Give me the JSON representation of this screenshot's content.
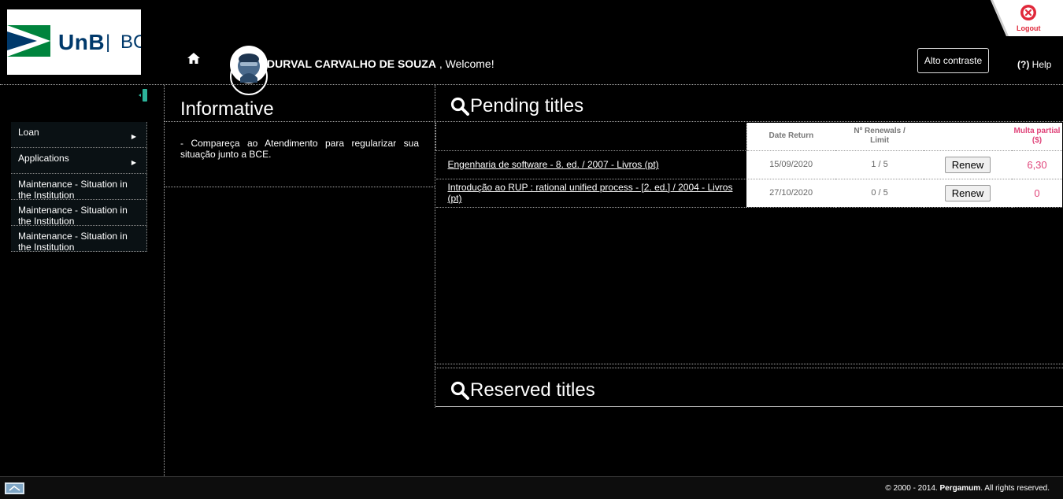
{
  "header": {
    "logo_text": "UnB",
    "logo_separator": "|",
    "logo_suffix": "BC",
    "user_name": "DURVAL CARVALHO DE SOUZA",
    "welcome_suffix": " , Welcome!",
    "contrast_button": "Alto contraste",
    "help_prefix": "(?)",
    "help_label": " Help",
    "logout_label": "Logout"
  },
  "sidebar": {
    "items": [
      {
        "label": "Loan",
        "has_arrow": true
      },
      {
        "label": "Applications",
        "has_arrow": true
      },
      {
        "label": "Maintenance - Situation in the Institution",
        "has_arrow": false
      },
      {
        "label": "Maintenance - Situation in the Institution",
        "has_arrow": false
      },
      {
        "label": "Maintenance - Situation in the Institution",
        "has_arrow": false
      }
    ]
  },
  "informative": {
    "title": "Informative",
    "text": "- Compareça ao Atendimento para regularizar sua situação junto a BCE."
  },
  "pending": {
    "title": "Pending titles",
    "columns": {
      "date_return": "Date Return",
      "renewals": "Nº Renewals / Limit",
      "multa": "Multa partial ($)"
    },
    "rows": [
      {
        "title": "Engenharia de software - 8. ed. / 2007 - Livros (pt)",
        "date": "15/09/2020",
        "renewals": "1 / 5",
        "renew_label": "Renew",
        "multa": "6,30"
      },
      {
        "title": "Introdução ao RUP : rational unified process - [2. ed.] / 2004 - Livros (pt)",
        "date": "27/10/2020",
        "renewals": "0 / 5",
        "renew_label": "Renew",
        "multa": "0"
      }
    ]
  },
  "reserved": {
    "title": "Reserved titles"
  },
  "footer": {
    "copyright_prefix": "© 2000 - 2014. ",
    "brand": "Pergamum",
    "copyright_suffix": ". All rights reserved."
  },
  "colors": {
    "accent_red": "#e0283a",
    "multa_pink": "#e0447a",
    "logo_blue": "#00396b",
    "logo_green": "#00843d"
  }
}
